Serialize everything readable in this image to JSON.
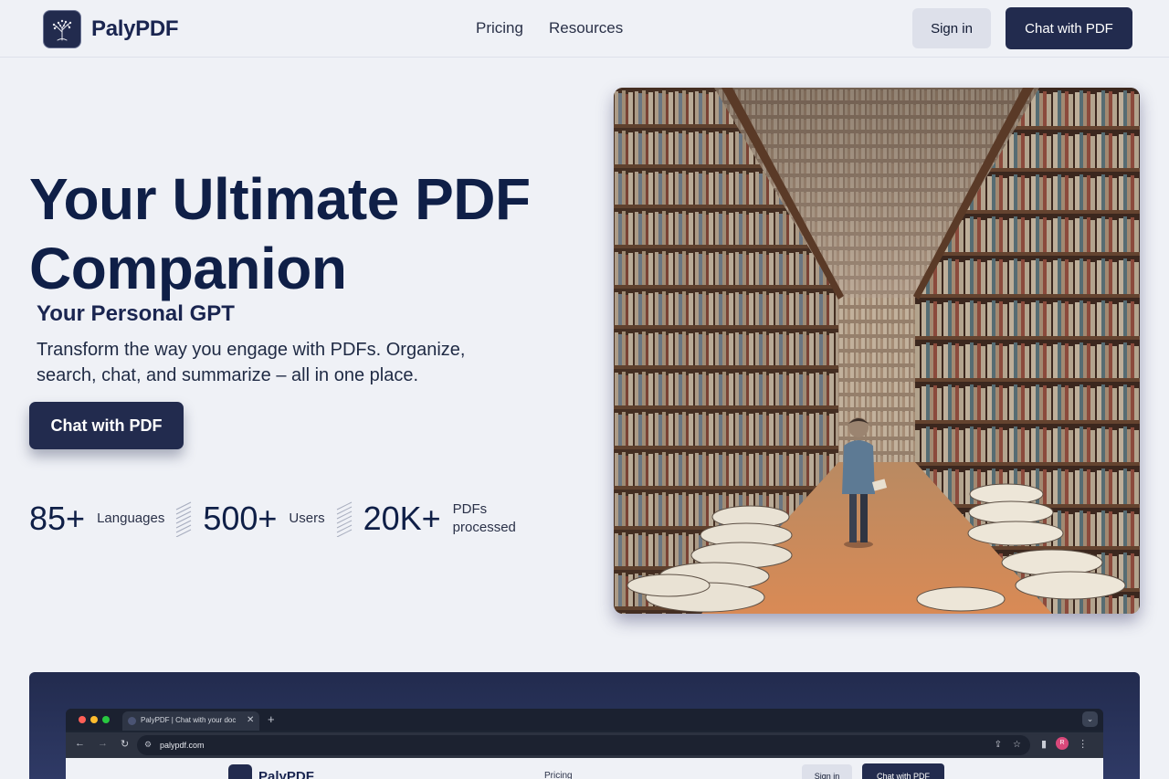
{
  "header": {
    "logo_text": "PalyPDF",
    "nav": [
      {
        "label": "Pricing"
      },
      {
        "label": "Resources"
      }
    ],
    "signin_label": "Sign in",
    "cta_label": "Chat with PDF"
  },
  "hero": {
    "title": "Your Ultimate PDF Companion",
    "subtitle": "Your Personal GPT",
    "description": "Transform the way you engage with PDFs. Organize, search, chat, and summarize – all in one place.",
    "cta_label": "Chat with PDF",
    "image_icon": "library-bookshelves-illustration"
  },
  "stats": [
    {
      "value": "85+",
      "label": "Languages"
    },
    {
      "value": "500+",
      "label": "Users"
    },
    {
      "value": "20K+",
      "label": "PDFs processed"
    }
  ],
  "demo": {
    "tab_title": "PalyPDF | Chat with your doc",
    "url": "palypdf.com",
    "profile_initial": "R",
    "preview": {
      "logo_text": "PalyPDF",
      "pricing": "Pricing",
      "signin": "Sign in",
      "cta": "Chat with PDF"
    }
  },
  "colors": {
    "accent": "#222b4e",
    "background": "#eff1f6",
    "heading": "#0f1f47"
  }
}
